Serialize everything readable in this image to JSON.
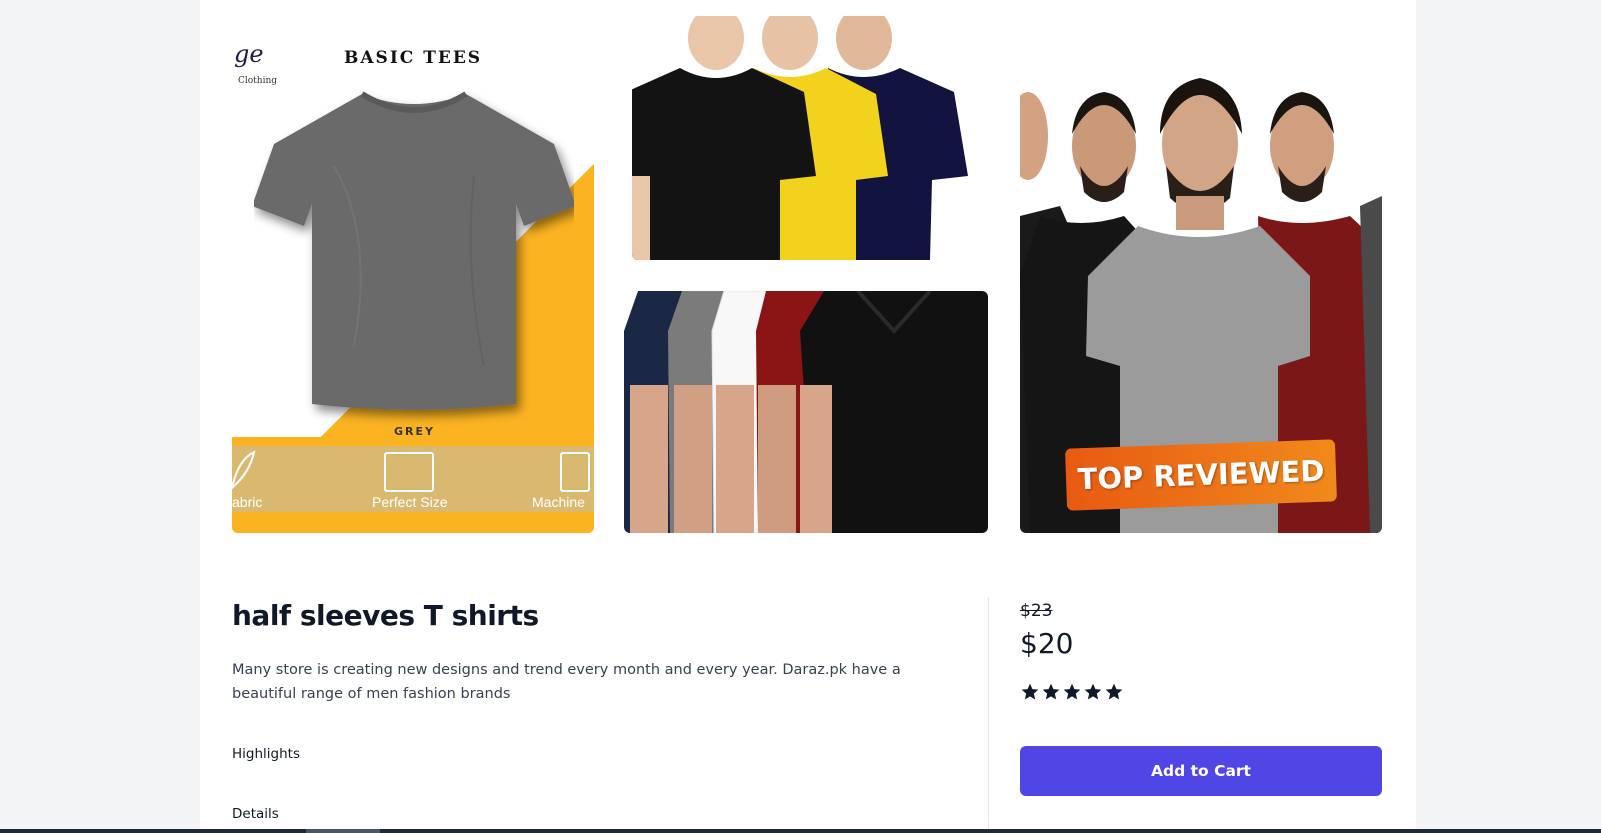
{
  "gallery": {
    "image1": {
      "brand_logo": "ge",
      "brand_sub": "Clothing",
      "title": "BASIC TEES",
      "color_label": "GREY",
      "features": [
        "abric",
        "Perfect Size",
        "Machine"
      ]
    },
    "image4": {
      "badge": "TOP REVIEWED"
    }
  },
  "product": {
    "title": "half sleeves T shirts",
    "description": "Many store is creating new designs and trend every month and every year. Daraz.pk have a beautiful range of men fashion brands",
    "highlights_label": "Highlights",
    "details_label": "Details"
  },
  "pricing": {
    "old_price": "$23",
    "price": "$20",
    "rating": 5,
    "rating_max": 5
  },
  "actions": {
    "add_to_cart": "Add to Cart"
  },
  "colors": {
    "accent": "#4f46e5",
    "page_bg": "#f3f4f6",
    "yellow": "#fbb321",
    "badge": "#e85a12"
  }
}
